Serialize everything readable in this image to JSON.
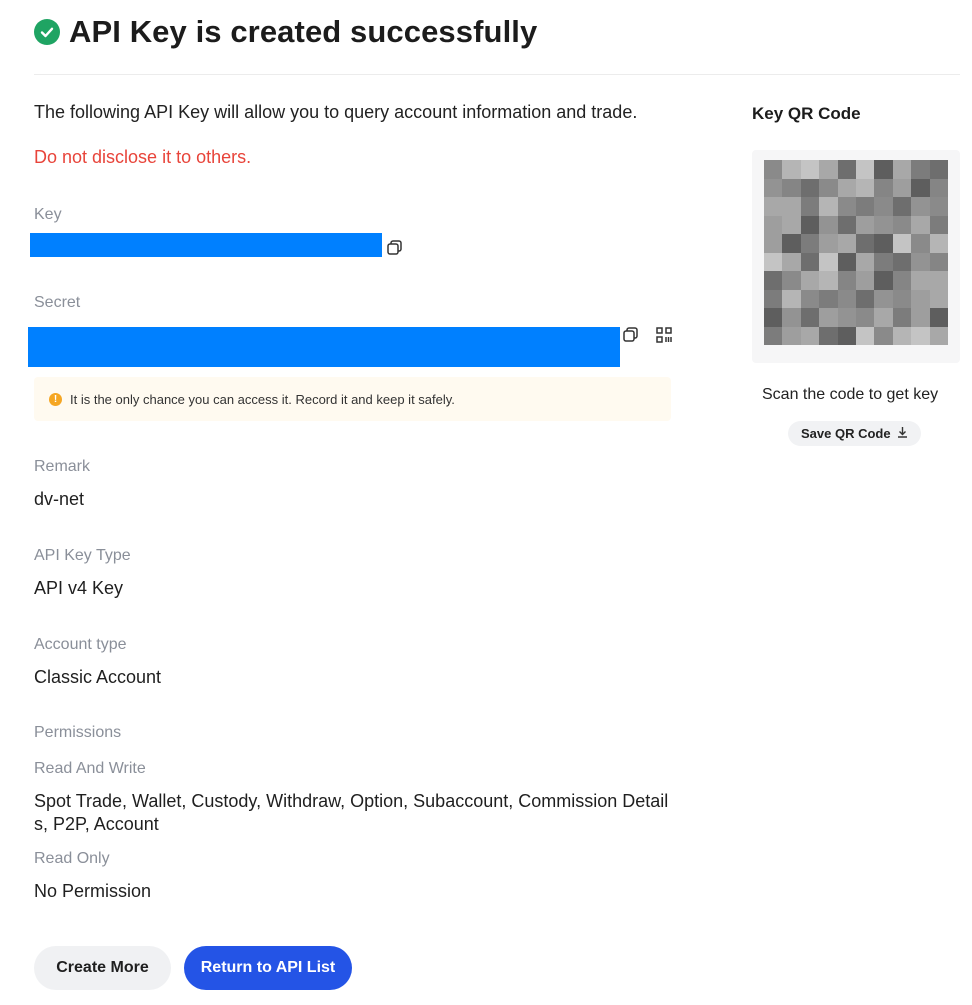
{
  "header": {
    "title": "API Key is created successfully"
  },
  "intro": {
    "text": "The following API Key will allow you to query account information and trade.",
    "warning": "Do not disclose it to others."
  },
  "key": {
    "label": "Key"
  },
  "secret": {
    "label": "Secret"
  },
  "notice": {
    "text": "It is the only chance you can access it. Record it and keep it safely."
  },
  "remark": {
    "label": "Remark",
    "value": "dv-net"
  },
  "key_type": {
    "label": "API Key Type",
    "value": "API v4 Key"
  },
  "account_type": {
    "label": "Account type",
    "value": "Classic Account"
  },
  "permissions": {
    "label": "Permissions",
    "read_write_label": "Read And Write",
    "read_write_value": "Spot Trade, Wallet, Custody, Withdraw, Option, Subaccount, Commission Details, P2P, Account",
    "read_only_label": "Read Only",
    "read_only_value": "No Permission"
  },
  "qr": {
    "title": "Key QR Code",
    "caption": "Scan the code to get key",
    "save_label": "Save QR Code"
  },
  "buttons": {
    "create_more": "Create More",
    "return": "Return to API List"
  },
  "colors": {
    "accent": "#2454e6",
    "success": "#1fa463",
    "danger": "#e8443a",
    "redaction": "#0080ff"
  }
}
